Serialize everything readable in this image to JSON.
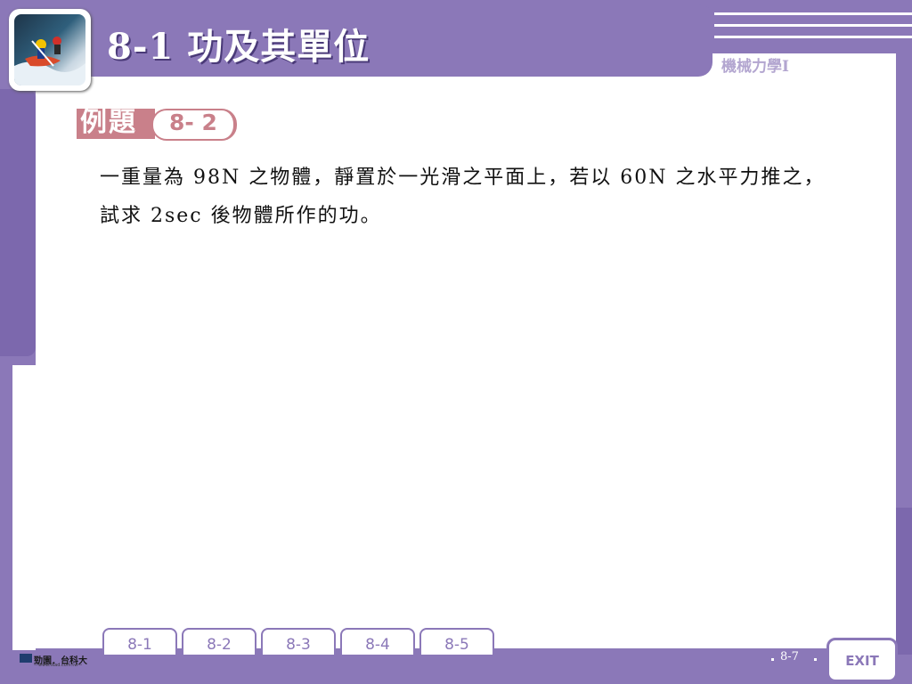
{
  "header": {
    "title": "8-1  功及其單位",
    "subject": "機械力學I"
  },
  "example": {
    "label": "例題",
    "number": "8- 2"
  },
  "problem": {
    "lines": [
      "一重量為 98N 之物體，靜置於一光滑之平面上，若以 60N 之水平力推之，",
      "試求 2sec 後物體所作的功。"
    ]
  },
  "nav": {
    "tabs": [
      {
        "label": "8-1"
      },
      {
        "label": "8-2"
      },
      {
        "label": "8-3"
      },
      {
        "label": "8-4"
      },
      {
        "label": "8-5"
      }
    ],
    "exit_label": "EXIT"
  },
  "footer": {
    "logo_text": "勁園．台科大",
    "logo_url": "—www.tkad.com.tw—",
    "page_number": "8-7"
  },
  "colors": {
    "frame": "#8b78b8",
    "accent": "#c9808a"
  }
}
